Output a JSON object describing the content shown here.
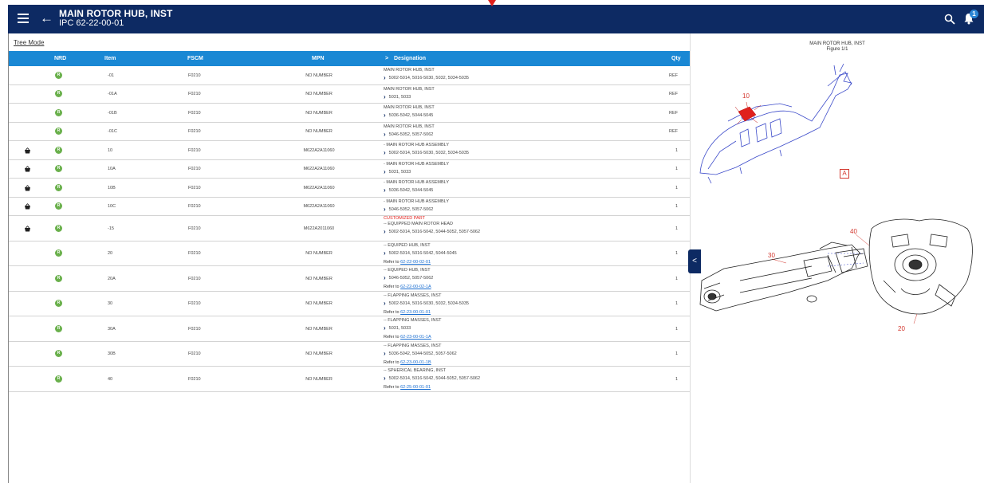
{
  "header": {
    "title": "MAIN ROTOR HUB, INST",
    "subtitle": "IPC 62-22-00-01",
    "notification_count": "1"
  },
  "tree_mode_label": "Tree Mode",
  "table": {
    "columns": {
      "nrd": "NRD",
      "item": "Item",
      "fscm": "FSCM",
      "mpn": "MPN",
      "designation": "Designation",
      "qty": "Qty"
    },
    "rows": [
      {
        "basket": false,
        "nrd": "R",
        "item": "-01",
        "fscm": "F0210",
        "mpn": "NO NUMBER",
        "title": "MAIN ROTOR HUB, INST",
        "serial": "5002-5014, 5016-5030, 5032, 5034-5035",
        "refer_label": "",
        "refer_link": "",
        "custom": "",
        "qty": "REF"
      },
      {
        "basket": false,
        "nrd": "R",
        "item": "-01A",
        "fscm": "F0210",
        "mpn": "NO NUMBER",
        "title": "MAIN ROTOR HUB, INST",
        "serial": "5031, 5033",
        "refer_label": "",
        "refer_link": "",
        "custom": "",
        "qty": "REF"
      },
      {
        "basket": false,
        "nrd": "R",
        "item": "-01B",
        "fscm": "F0210",
        "mpn": "NO NUMBER",
        "title": "MAIN ROTOR HUB, INST",
        "serial": "5036-5042, 5044-5045",
        "refer_label": "",
        "refer_link": "",
        "custom": "",
        "qty": "REF"
      },
      {
        "basket": false,
        "nrd": "R",
        "item": "-01C",
        "fscm": "F0210",
        "mpn": "NO NUMBER",
        "title": "MAIN ROTOR HUB, INST",
        "serial": "5046-5052, 5057-5062",
        "refer_label": "",
        "refer_link": "",
        "custom": "",
        "qty": "REF"
      },
      {
        "basket": true,
        "nrd": "R",
        "item": "10",
        "fscm": "F0210",
        "mpn": "M622A2A11060",
        "title": "- MAIN ROTOR HUB ASSEMBLY",
        "serial": "5002-5014, 5016-5030, 5032, 5034-5035",
        "refer_label": "",
        "refer_link": "",
        "custom": "",
        "qty": "1"
      },
      {
        "basket": true,
        "nrd": "R",
        "item": "10A",
        "fscm": "F0210",
        "mpn": "M622A2A11060",
        "title": "- MAIN ROTOR HUB ASSEMBLY",
        "serial": "5031, 5033",
        "refer_label": "",
        "refer_link": "",
        "custom": "",
        "qty": "1"
      },
      {
        "basket": true,
        "nrd": "R",
        "item": "10B",
        "fscm": "F0210",
        "mpn": "M622A2A11060",
        "title": "- MAIN ROTOR HUB ASSEMBLY",
        "serial": "5036-5042, 5044-5045",
        "refer_label": "",
        "refer_link": "",
        "custom": "",
        "qty": "1"
      },
      {
        "basket": true,
        "nrd": "R",
        "item": "10C",
        "fscm": "F0210",
        "mpn": "M622A2A11060",
        "title": "- MAIN ROTOR HUB ASSEMBLY",
        "serial": "5046-5052, 5057-5062",
        "refer_label": "",
        "refer_link": "",
        "custom": "",
        "qty": "1"
      },
      {
        "basket": true,
        "nrd": "R",
        "item": "-15",
        "fscm": "F0210",
        "mpn": "M622A2011060",
        "title": "-- EQUIPPED MAIN ROTOR HEAD",
        "serial": "5002-5014, 5016-5042, 5044-5052, 5057-5062",
        "refer_label": "",
        "refer_link": "",
        "custom": "CUSTOMIZED PART",
        "qty": "1"
      },
      {
        "basket": false,
        "nrd": "R",
        "item": "20",
        "fscm": "F0210",
        "mpn": "NO NUMBER",
        "title": "-- EQUIPED HUB, INST",
        "serial": "5002-5014, 5016-5042, 5044-5045",
        "refer_label": "Refer to",
        "refer_link": "62-22-00-02-01",
        "custom": "",
        "qty": "1"
      },
      {
        "basket": false,
        "nrd": "R",
        "item": "20A",
        "fscm": "F0210",
        "mpn": "NO NUMBER",
        "title": "-- EQUIPED HUB, INST",
        "serial": "5046-5052, 5057-5062",
        "refer_label": "Refer to",
        "refer_link": "62-22-00-02-1A",
        "custom": "",
        "qty": "1"
      },
      {
        "basket": false,
        "nrd": "R",
        "item": "30",
        "fscm": "F0210",
        "mpn": "NO NUMBER",
        "title": "-- FLAPPING MASSES, INST",
        "serial": "5002-5014, 5016-5030, 5032, 5034-5035",
        "refer_label": "Refer to",
        "refer_link": "62-23-00-01-01",
        "custom": "",
        "qty": "1"
      },
      {
        "basket": false,
        "nrd": "R",
        "item": "30A",
        "fscm": "F0210",
        "mpn": "NO NUMBER",
        "title": "-- FLAPPING MASSES, INST",
        "serial": "5031, 5033",
        "refer_label": "Refer to",
        "refer_link": "62-23-00-01-1A",
        "custom": "",
        "qty": "1"
      },
      {
        "basket": false,
        "nrd": "R",
        "item": "30B",
        "fscm": "F0210",
        "mpn": "NO NUMBER",
        "title": "-- FLAPPING MASSES, INST",
        "serial": "5036-5042, 5044-5052, 5057-5062",
        "refer_label": "Refer to",
        "refer_link": "62-23-00-01-1B",
        "custom": "",
        "qty": "1"
      },
      {
        "basket": false,
        "nrd": "R",
        "item": "40",
        "fscm": "F0210",
        "mpn": "NO NUMBER",
        "title": "-- SPHERICAL BEARING, INST",
        "serial": "5002-5014, 5016-5042, 5044-5052, 5057-5062",
        "refer_label": "Refer to",
        "refer_link": "62-25-00-01-01",
        "custom": "",
        "qty": "1"
      }
    ]
  },
  "figure": {
    "title": "MAIN ROTOR HUB, INST",
    "subtitle": "Figure 1/1",
    "callouts": {
      "c10": "10",
      "c40": "40",
      "c30": "30",
      "c20": "20",
      "view_a": "A"
    }
  },
  "colors": {
    "appbar": "#0d2a63",
    "table_header": "#1a88d4",
    "nrd_badge": "#6ab04c",
    "callout": "#d3382f",
    "link": "#1a6ed1"
  },
  "icons": {
    "menu": "menu-icon",
    "back": "arrow-left-icon",
    "search": "search-icon",
    "bell": "bell-icon",
    "basket": "basket-icon",
    "chevron": "chevron-right-icon",
    "collapse": "chevron-left-icon"
  }
}
